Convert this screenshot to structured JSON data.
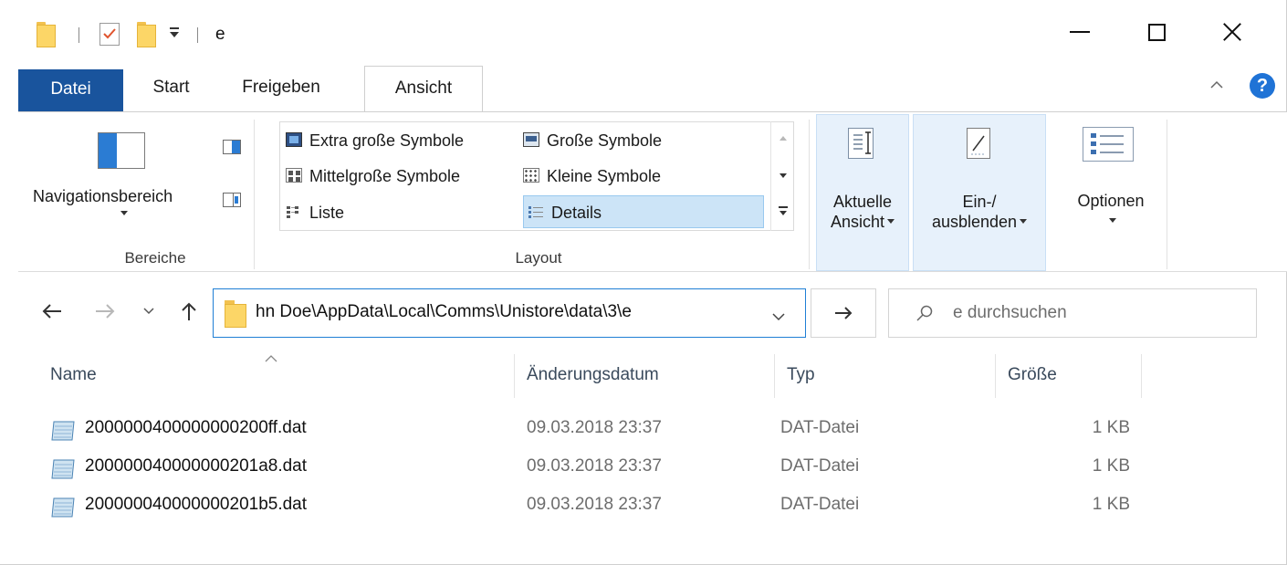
{
  "window": {
    "title": "e",
    "controls": {
      "minimize": "minimize",
      "maximize": "maximize",
      "close": "close"
    }
  },
  "ribbon_tabs": [
    {
      "label": "Datei"
    },
    {
      "label": "Start"
    },
    {
      "label": "Freigeben"
    },
    {
      "label": "Ansicht",
      "active": true
    }
  ],
  "ribbon": {
    "bereiche": {
      "navigationsbereich_label": "Navigationsbereich",
      "group_label": "Bereiche"
    },
    "layout": {
      "group_label": "Layout",
      "items": [
        {
          "label": "Extra große Symbole",
          "icon": "extra-large-icons-icon"
        },
        {
          "label": "Große Symbole",
          "icon": "large-icons-icon"
        },
        {
          "label": "Mittelgroße Symbole",
          "icon": "medium-icons-icon"
        },
        {
          "label": "Kleine Symbole",
          "icon": "small-icons-icon"
        },
        {
          "label": "Liste",
          "icon": "list-icon"
        },
        {
          "label": "Details",
          "icon": "details-icon",
          "selected": true
        }
      ]
    },
    "aktuelle_ansicht": {
      "line1": "Aktuelle",
      "line2": "Ansicht"
    },
    "ein_ausblenden": {
      "line1": "Ein-/",
      "line2": "ausblenden"
    },
    "optionen": {
      "label": "Optionen"
    }
  },
  "address_bar": {
    "path": "hn Doe\\AppData\\Local\\Comms\\Unistore\\data\\3\\e",
    "search_placeholder": "e durchsuchen"
  },
  "file_list": {
    "columns": [
      "Name",
      "Änderungsdatum",
      "Typ",
      "Größe"
    ],
    "sorted_by": "Name",
    "rows": [
      {
        "name": "2000000400000000200ff.dat",
        "date": "09.03.2018 23:37",
        "type": "DAT-Datei",
        "size": "1 KB"
      },
      {
        "name": "200000040000000201a8.dat",
        "date": "09.03.2018 23:37",
        "type": "DAT-Datei",
        "size": "1 KB"
      },
      {
        "name": "200000040000000201b5.dat",
        "date": "09.03.2018 23:37",
        "type": "DAT-Datei",
        "size": "1 KB"
      }
    ]
  },
  "colors": {
    "file_tab_bg": "#19549d",
    "accent_blue": "#1f7fd5",
    "selected_bg": "#cce4f7",
    "folder_yellow": "#fcd667",
    "help_blue": "#1f73d6"
  }
}
